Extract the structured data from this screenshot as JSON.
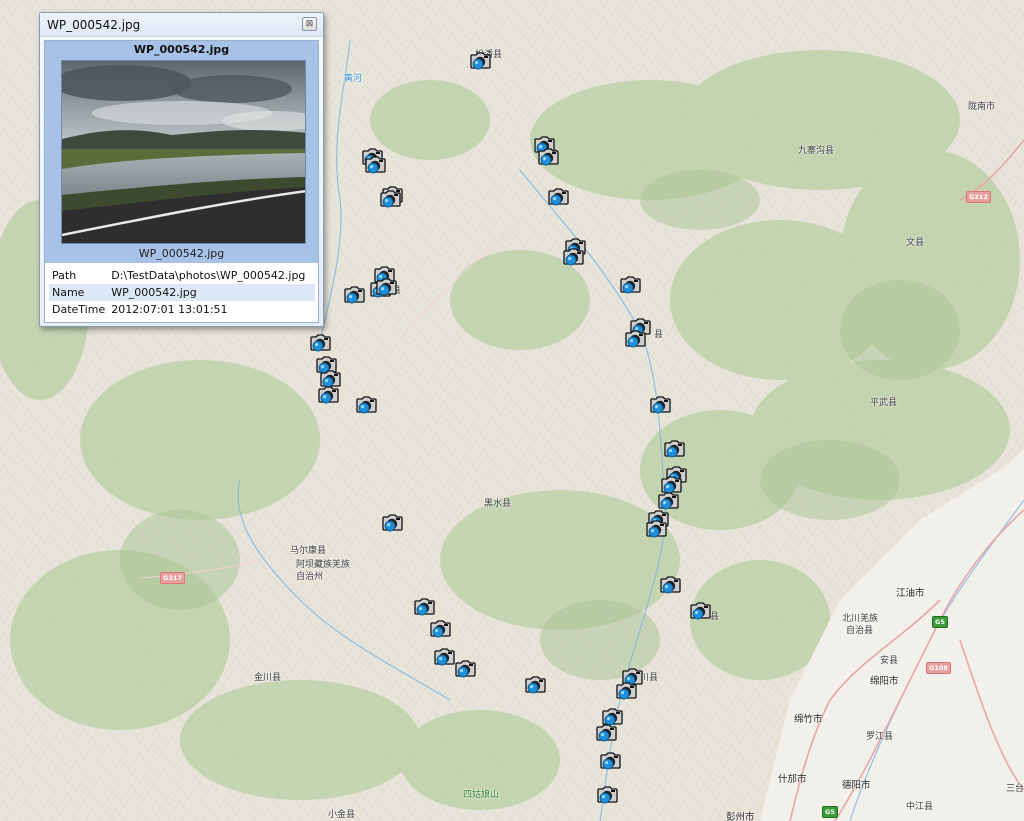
{
  "popup": {
    "window_title": "WP_000542.jpg",
    "close_glyph": "⊠",
    "photo_title": "WP_000542.jpg",
    "photo_caption": "WP_000542.jpg",
    "attributes": [
      {
        "key": "Path",
        "value": "D:\\TestData\\photos\\WP_000542.jpg"
      },
      {
        "key": "Name",
        "value": "WP_000542.jpg"
      },
      {
        "key": "DateTime",
        "value": "2012:07:01 13:01:51"
      }
    ]
  },
  "map": {
    "marker_icon": "camera-icon",
    "marker_count": 48,
    "colors": {
      "terrain": "#e7e4da",
      "vegetation": "#b9cfa4",
      "plain": "#f1efea",
      "river": "#7fb3de",
      "road": "#e9a6a6",
      "marker_blue": "#1e8fd8"
    },
    "place_labels": {
      "songpan": "松潘县",
      "jiuzhaigou": "九寨沟县",
      "longnan": "陇南市",
      "wenxian": "文县",
      "pingwu": "平武县",
      "heishui": "黑水县",
      "maerkang": "马尔康县",
      "aba1": "阿坝藏族羌族",
      "aba2": "自治州",
      "jinchuan": "金川县",
      "jiangyou": "江油市",
      "beichuan1": "北川羌族",
      "beichuan2": "自治县",
      "anxian": "安县",
      "mianyang": "绵阳市",
      "mianzhu": "绵竹市",
      "luojiang": "罗江县",
      "shifang": "什邡市",
      "deyang": "德阳市",
      "zhongjiang": "中江县",
      "santai": "三台",
      "xiaojin": "小金县",
      "siguniangshan": "四姑娘山",
      "pengzhou": "彭州市",
      "huanghe": "黄河",
      "frag1": "县",
      "frag2": "川县",
      "frag3": "县",
      "frag4": "县",
      "frag5": "县"
    },
    "road_shields": {
      "g212": "G212",
      "g317": "G317",
      "g108": "G108",
      "g5": "G5",
      "g5b": "G5"
    }
  }
}
